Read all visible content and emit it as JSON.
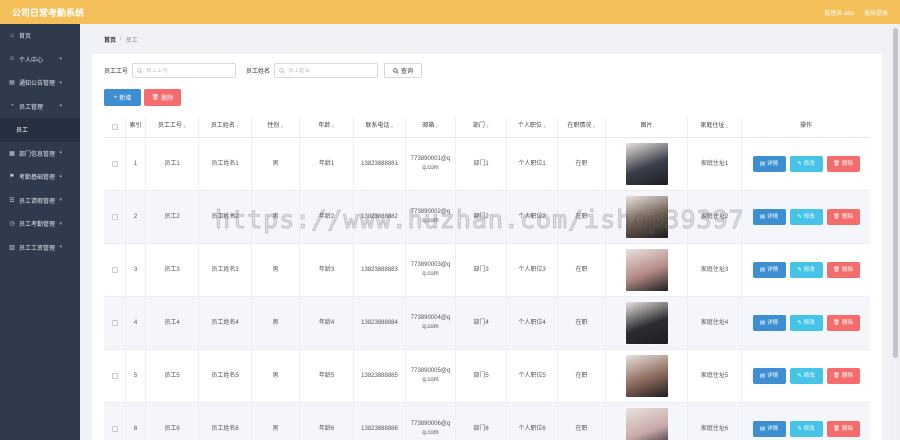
{
  "header": {
    "title": "公司日常考勤系统",
    "user": "管理员 abo",
    "logout": "退出登录"
  },
  "sidebar": {
    "items": [
      {
        "label": "首页",
        "icon": "home-icon",
        "arrow": false
      },
      {
        "label": "个人中心",
        "icon": "user-icon",
        "arrow": true
      },
      {
        "label": "通知公告管理",
        "icon": "notice-icon",
        "arrow": true
      },
      {
        "label": "员工管理",
        "icon": "staff-icon",
        "arrow": true
      },
      {
        "label": "员工",
        "icon": "",
        "arrow": false,
        "sub": true
      },
      {
        "label": "部门信息管理",
        "icon": "dept-icon",
        "arrow": true
      },
      {
        "label": "考勤基础管理",
        "icon": "flag-icon",
        "arrow": true
      },
      {
        "label": "员工请假管理",
        "icon": "leave-icon",
        "arrow": true
      },
      {
        "label": "员工考勤管理",
        "icon": "clock-icon",
        "arrow": true
      },
      {
        "label": "员工工资管理",
        "icon": "wage-icon",
        "arrow": true
      }
    ]
  },
  "breadcrumb": {
    "home": "首页",
    "sep": "/",
    "current": "员工"
  },
  "search": {
    "label_no": "员工工号",
    "ph_no": "员工工号",
    "label_name": "员工姓名",
    "ph_name": "员工姓名",
    "query": "查询"
  },
  "actions": {
    "add": "新增",
    "delete": "删除"
  },
  "table": {
    "headers": [
      "索引",
      "员工工号",
      "员工姓名",
      "性别",
      "年龄",
      "联系电话",
      "邮箱",
      "部门",
      "个人职位",
      "在职情况",
      "图片",
      "家庭住址",
      "操作"
    ],
    "op_labels": {
      "detail": "详情",
      "edit": "修改",
      "delete": "删除"
    },
    "rows": [
      {
        "idx": "1",
        "no": "员工1",
        "name": "员工姓名1",
        "sex": "男",
        "age": "年龄1",
        "phone": "13823888881",
        "email": "773890001@qq.com",
        "dept": "部门1",
        "pos": "个人职位1",
        "status": "在职",
        "addr": "家庭住址1",
        "photo": "#3a3f4a"
      },
      {
        "idx": "2",
        "no": "员工2",
        "name": "员工姓名2",
        "sex": "男",
        "age": "年龄2",
        "phone": "13823888882",
        "email": "773890002@qq.com",
        "dept": "部门2",
        "pos": "个人职位2",
        "status": "在职",
        "addr": "家庭住址2",
        "photo": "#6b5a4e"
      },
      {
        "idx": "3",
        "no": "员工3",
        "name": "员工姓名3",
        "sex": "男",
        "age": "年龄3",
        "phone": "13823888883",
        "email": "773890003@qq.com",
        "dept": "部门3",
        "pos": "个人职位3",
        "status": "在职",
        "addr": "家庭住址3",
        "photo": "#b58a86"
      },
      {
        "idx": "4",
        "no": "员工4",
        "name": "员工姓名4",
        "sex": "男",
        "age": "年龄4",
        "phone": "13823888884",
        "email": "773890004@qq.com",
        "dept": "部门4",
        "pos": "个人职位4",
        "status": "在职",
        "addr": "家庭住址4",
        "photo": "#2a2c30"
      },
      {
        "idx": "5",
        "no": "员工5",
        "name": "员工姓名5",
        "sex": "男",
        "age": "年龄5",
        "phone": "13823888885",
        "email": "773890005@qq.com",
        "dept": "部门5",
        "pos": "个人职位5",
        "status": "在职",
        "addr": "家庭住址5",
        "photo": "#8c6a5c"
      },
      {
        "idx": "6",
        "no": "员工6",
        "name": "员工姓名6",
        "sex": "男",
        "age": "年龄6",
        "phone": "13823888886",
        "email": "773890006@qq.com",
        "dept": "部门6",
        "pos": "个人职位6",
        "status": "在职",
        "addr": "家庭住址6",
        "photo": "#c9a9a8"
      }
    ]
  },
  "watermark": "https://www.huzhan.com/ishop39397",
  "colors": {
    "header": "#f5c05a",
    "sidebar": "#2f3a4d",
    "primary": "#3d8fd1",
    "danger": "#f56c6c",
    "info": "#45c4e8"
  }
}
